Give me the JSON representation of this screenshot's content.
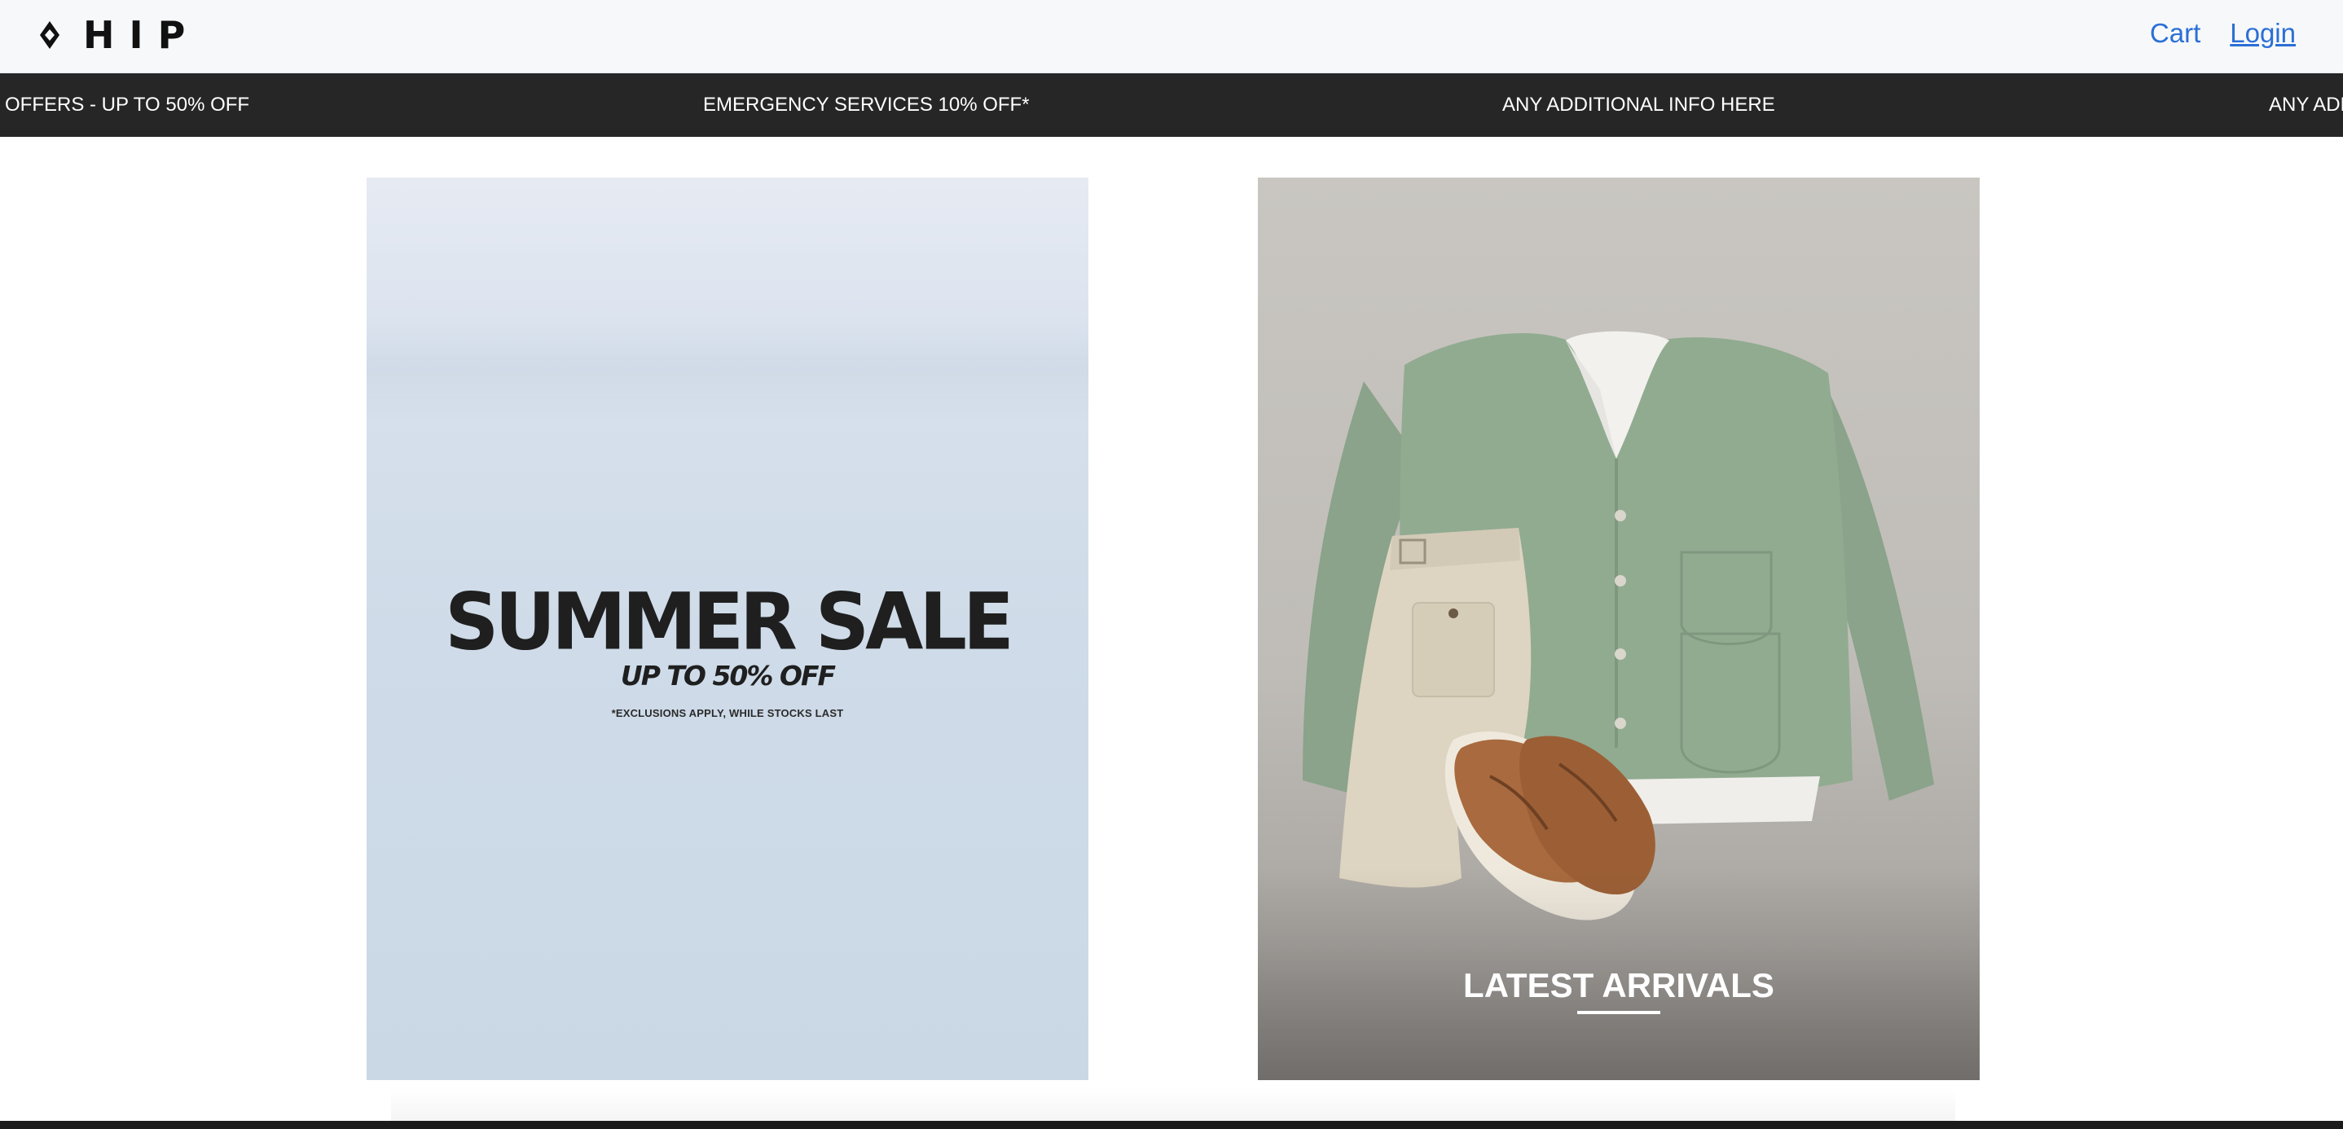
{
  "header": {
    "logo_text": "HIP",
    "logo_icon": "diamond-icon",
    "cart_label": "Cart",
    "login_label": "Login",
    "link_color": "#2a6fd6"
  },
  "announcement_bar": {
    "background": "#262626",
    "items": [
      "OFFERS - UP TO 50% OFF",
      "EMERGENCY SERVICES 10% OFF*",
      "ANY ADDITIONAL INFO HERE",
      "ANY ADD"
    ]
  },
  "promo_tiles": [
    {
      "title": "SUMMER SALE",
      "subtitle": "UP TO 50% OFF",
      "note": "*EXCLUSIONS APPLY, WHILE STOCKS LAST"
    },
    {
      "title": "LATEST ARRIVALS",
      "image": "flat-lay of green cardigan, cream shorts and brown suede boots"
    }
  ]
}
